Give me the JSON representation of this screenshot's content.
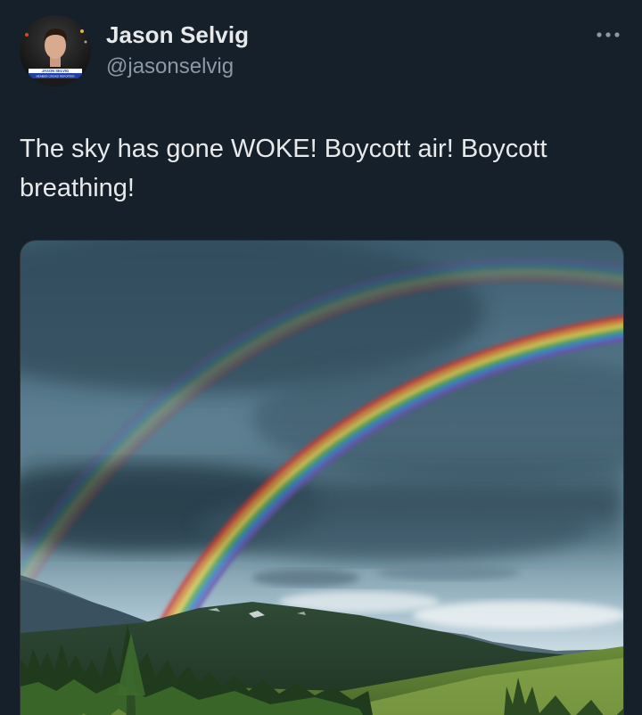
{
  "tweet": {
    "author": {
      "name": "Jason Selvig",
      "handle": "@jasonselvig",
      "avatar_caption": "JASON SELVIG",
      "avatar_subcaption": "MEMBER CROWD REPORTER"
    },
    "text": "The sky has gone WOKE! Boycott air! Boycott breathing!",
    "more_icon": "more-horizontal-icon",
    "media": {
      "kind": "photo",
      "subject": "rainbow-over-mountain-forest"
    }
  },
  "colors": {
    "background": "#15202b",
    "primary_text": "#e7e9ea",
    "secondary_text": "#8b98a5"
  }
}
